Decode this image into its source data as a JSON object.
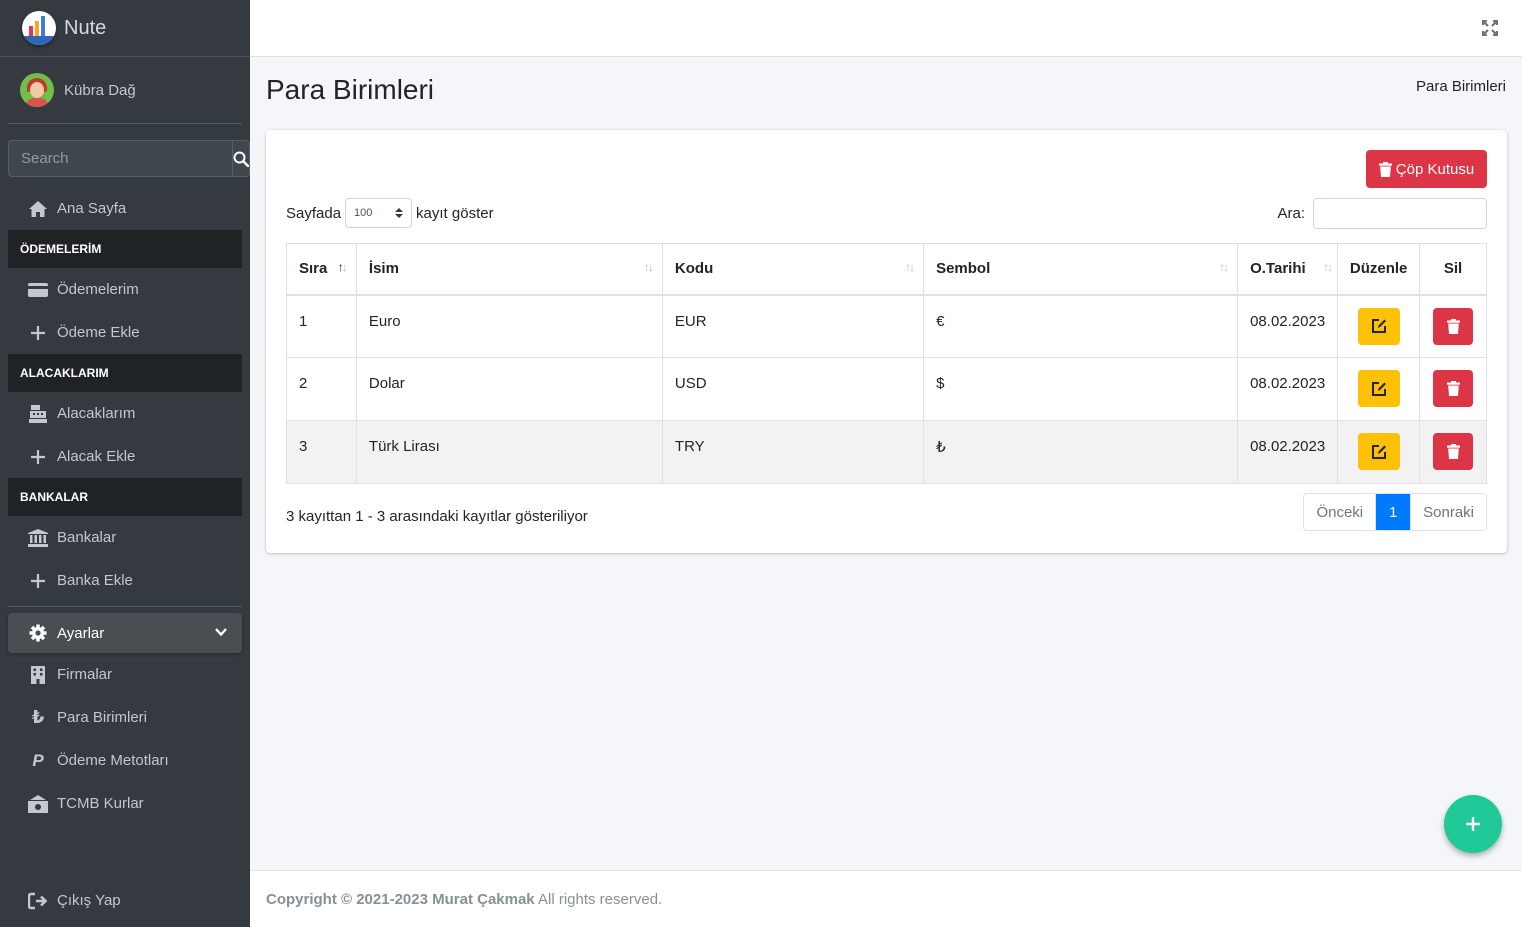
{
  "app": {
    "brand": "Nute"
  },
  "user": {
    "name": "Kübra Dağ"
  },
  "sidebar": {
    "search_placeholder": "Search",
    "home": "Ana Sayfa",
    "sections": [
      {
        "header": "ÖDEMELERİM",
        "items": [
          "Ödemelerim",
          "Ödeme Ekle"
        ]
      },
      {
        "header": "ALACAKLARIM",
        "items": [
          "Alacaklarım",
          "Alacak Ekle"
        ]
      },
      {
        "header": "BANKALAR",
        "items": [
          "Bankalar",
          "Banka Ekle"
        ]
      }
    ],
    "settings": {
      "label": "Ayarlar",
      "items": [
        "Firmalar",
        "Para Birimleri",
        "Ödeme Metotları",
        "TCMB Kurlar"
      ]
    },
    "logout": "Çıkış Yap"
  },
  "page": {
    "title": "Para Birimleri",
    "breadcrumb": "Para Birimleri",
    "trash_button": "Çöp Kutusu",
    "length_prefix": "Sayfada",
    "length_value": "100",
    "length_suffix": "kayıt göster",
    "filter_label": "Ara:",
    "table": {
      "headers": [
        "Sıra",
        "İsim",
        "Kodu",
        "Sembol",
        "O.Tarihi",
        "Düzenle",
        "Sil"
      ],
      "rows": [
        {
          "sira": "1",
          "isim": "Euro",
          "kodu": "EUR",
          "sembol": "€",
          "tarih": "08.02.2023"
        },
        {
          "sira": "2",
          "isim": "Dolar",
          "kodu": "USD",
          "sembol": "$",
          "tarih": "08.02.2023"
        },
        {
          "sira": "3",
          "isim": "Türk Lirası",
          "kodu": "TRY",
          "sembol": "₺",
          "tarih": "08.02.2023"
        }
      ]
    },
    "info": "3 kayıttan 1 - 3 arasındaki kayıtlar gösteriliyor",
    "pagination": {
      "prev": "Önceki",
      "current": "1",
      "next": "Sonraki"
    }
  },
  "footer": {
    "copyright": "Copyright © 2021-2023 Murat Çakmak",
    "rights": " All rights reserved."
  },
  "colors": {
    "danger": "#dc3545",
    "warning": "#ffc107",
    "primary": "#007bff",
    "fab": "#20c997",
    "sidebar": "#343a40"
  }
}
